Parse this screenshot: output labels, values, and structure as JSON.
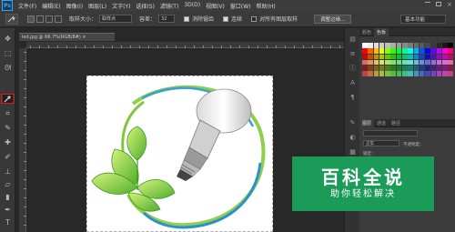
{
  "app": {
    "logo": "Ps"
  },
  "menubar": {
    "items": [
      "文件(F)",
      "编辑(E)",
      "图像(I)",
      "图层(L)",
      "文字(Y)",
      "选择(S)",
      "滤镜(T)",
      "3D(D)",
      "视图(V)",
      "窗口(W)",
      "帮助(H)"
    ]
  },
  "options": {
    "sample_label": "取样大小：",
    "sample_value": "取样点",
    "tolerance_label": "容差：",
    "tolerance_value": "32",
    "antialias_label": "消除锯齿",
    "contiguous_label": "连续",
    "all_layers_label": "对所有图层取样",
    "refine_edge_label": "调整边缘...",
    "workspace_value": "基本功能"
  },
  "document": {
    "tab_title": "led.jpg @ 66.7%(RGB/8#) ×"
  },
  "panels": {
    "swatches_tabs": [
      "颜色",
      "色板"
    ],
    "layers_tabs": [
      "图层",
      "通道",
      "路径"
    ],
    "blend_mode": "正常",
    "opacity_label": "不透明度：",
    "lock_label": "锁定："
  },
  "watermark": {
    "title": "百科全说",
    "subtitle": "助你轻松解决"
  },
  "colors": {
    "watermark_bg": "#1a9b58",
    "tool_highlight": "#e01818"
  }
}
